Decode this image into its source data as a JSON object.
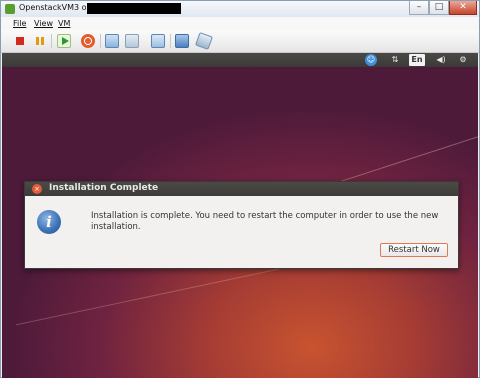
{
  "window": {
    "title": "OpenstackVM3 on",
    "minimize_glyph": "–",
    "maximize_glyph": "□",
    "close_glyph": "✕"
  },
  "menubar": {
    "items": [
      "File",
      "View",
      "VM"
    ]
  },
  "toolbar": {
    "buttons": [
      "stop-icon",
      "pause-icon",
      "play-icon",
      "reset-icon",
      "snapshot-icon",
      "revert-snapshot-icon",
      "snapshot-manager-icon",
      "fullscreen-icon",
      "unity-icon"
    ]
  },
  "guest_panel": {
    "accessibility_glyph": "☺",
    "network_glyph": "⇅",
    "language": "En",
    "volume_glyph": "◀)",
    "settings_glyph": "⚙"
  },
  "dialog": {
    "title": "Installation Complete",
    "close_glyph": "×",
    "icon_glyph": "i",
    "message": "Installation is complete. You need to restart the computer in order to use the new installation.",
    "restart_label": "Restart Now"
  },
  "colors": {
    "accent_button_border": "#e07a55",
    "desktop_top": "#4e1a3a",
    "desktop_bottom": "#c8532f"
  }
}
